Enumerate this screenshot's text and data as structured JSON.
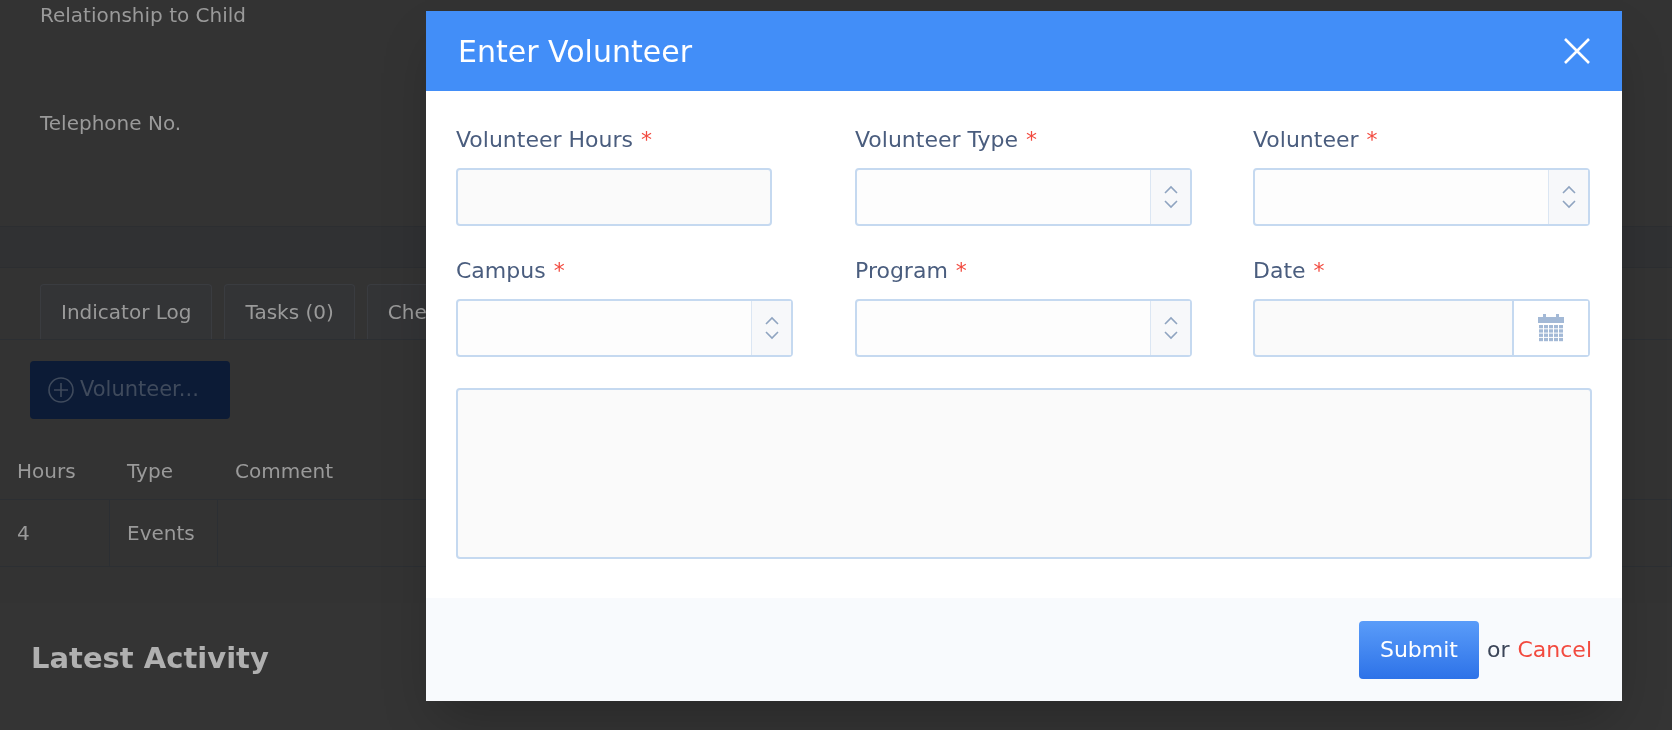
{
  "background": {
    "field_labels": [
      "Relationship to Child",
      "Telephone No."
    ],
    "tabs": [
      "Indicator Log",
      "Tasks (0)",
      "Che"
    ],
    "add_button": "Volunteer...",
    "table": {
      "columns": [
        "Hours",
        "Type",
        "Comment"
      ],
      "rows": [
        [
          "4",
          "Events",
          ""
        ]
      ]
    },
    "section_title": "Latest Activity"
  },
  "dialog": {
    "title": "Enter Volunteer",
    "fields": [
      {
        "label": "Volunteer Hours",
        "mark": "*",
        "kind": "text"
      },
      {
        "label": "Volunteer Type",
        "mark": "*",
        "kind": "select"
      },
      {
        "label": "Volunteer",
        "mark": "*",
        "kind": "select"
      },
      {
        "label": "Campus",
        "mark": "*",
        "kind": "select"
      },
      {
        "label": "Program",
        "mark": "*",
        "kind": "select"
      },
      {
        "label": "Date",
        "mark": "*",
        "kind": "date"
      }
    ],
    "submit": "Submit",
    "or": "or",
    "cancel": "Cancel"
  }
}
